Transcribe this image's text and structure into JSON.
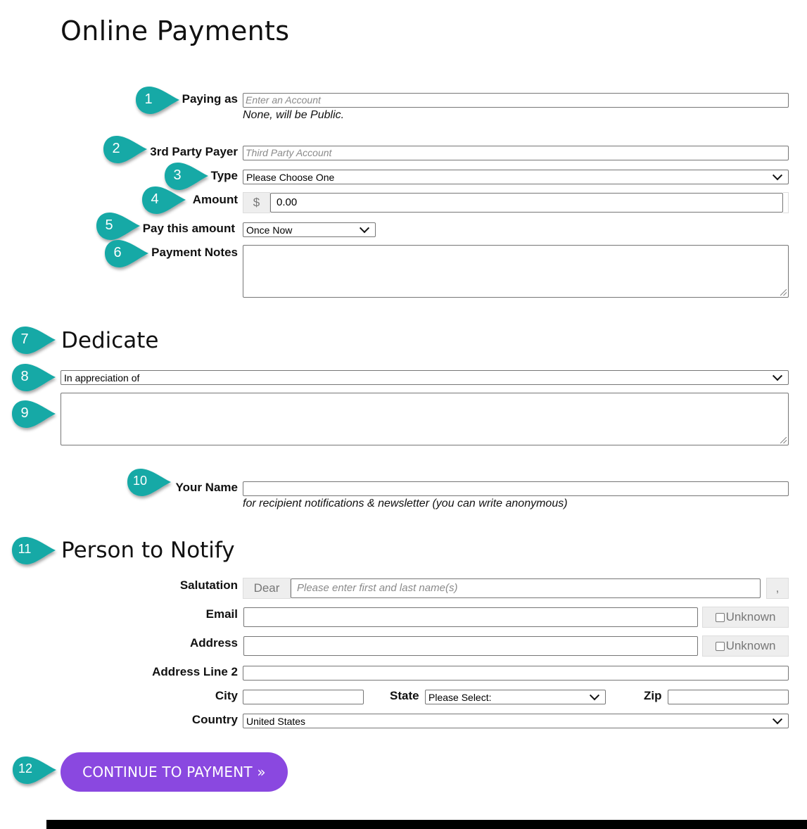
{
  "page": {
    "title": "Online Payments"
  },
  "payment": {
    "paying_as": {
      "label": "Paying as",
      "placeholder": "Enter an Account",
      "help": "None, will be Public."
    },
    "third_party": {
      "label": "3rd Party Payer",
      "placeholder": "Third Party Account"
    },
    "type": {
      "label": "Type",
      "selected": "Please Choose One"
    },
    "amount": {
      "label": "Amount",
      "currency_symbol": "$",
      "value": "0.00"
    },
    "frequency": {
      "label": "Pay this amount",
      "selected": "Once Now"
    },
    "notes": {
      "label": "Payment Notes",
      "value": ""
    }
  },
  "dedicate": {
    "heading": "Dedicate",
    "selected": "In appreciation of",
    "text": ""
  },
  "your_name": {
    "label": "Your Name",
    "value": "",
    "help": "for recipient notifications & newsletter (you can write anonymous)"
  },
  "notify": {
    "heading": "Person to Notify",
    "salutation": {
      "label": "Salutation",
      "prefix": "Dear",
      "placeholder": "Please enter first and last name(s)",
      "suffix": ","
    },
    "email": {
      "label": "Email",
      "unknown_label": "Unknown"
    },
    "address": {
      "label": "Address",
      "unknown_label": "Unknown"
    },
    "address2": {
      "label": "Address Line 2"
    },
    "city": {
      "label": "City"
    },
    "state": {
      "label": "State",
      "selected": "Please Select:"
    },
    "zip": {
      "label": "Zip"
    },
    "country": {
      "label": "Country",
      "selected": "United States"
    }
  },
  "actions": {
    "continue_label": "CONTINUE TO PAYMENT »"
  },
  "callouts": [
    "1",
    "2",
    "3",
    "4",
    "5",
    "6",
    "7",
    "8",
    "9",
    "10",
    "11",
    "12"
  ],
  "colors": {
    "callout": "#17a9a6",
    "button": "#8a48e0"
  }
}
